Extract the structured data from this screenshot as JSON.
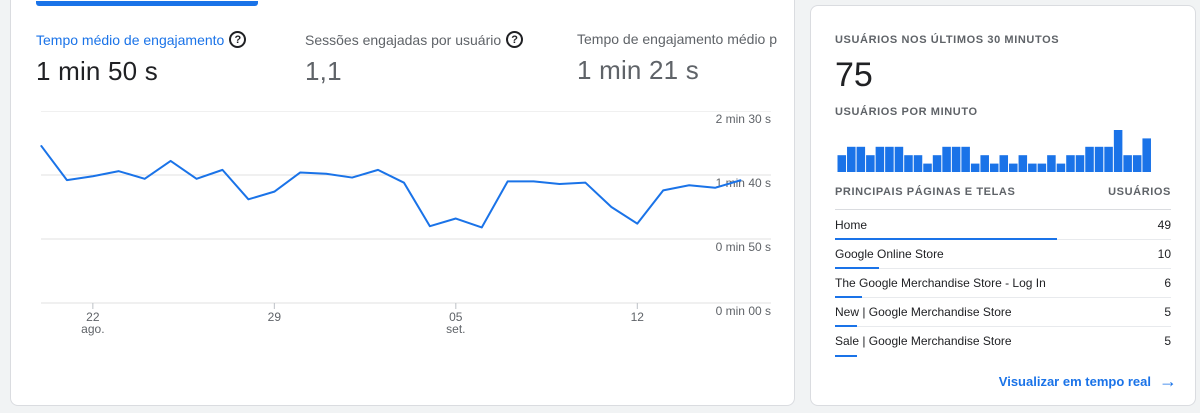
{
  "engagement_card": {
    "metrics": [
      {
        "label": "Tempo médio de engajamento",
        "value": "1 min 50 s",
        "active": true
      },
      {
        "label": "Sessões engajadas por usuário",
        "value": "1,1"
      },
      {
        "label": "Tempo de engajamento médio p",
        "value": "1 min 21 s"
      }
    ],
    "chart_data": {
      "type": "line",
      "y_ticks": [
        "2 min 30 s",
        "1 min 40 s",
        "0 min 50 s",
        "0 min 00 s"
      ],
      "y_tick_values": [
        150,
        100,
        50,
        0
      ],
      "ylim": [
        0,
        150
      ],
      "x_ticks": [
        {
          "day": "22",
          "month": "ago.",
          "index": 2
        },
        {
          "day": "29",
          "month": "",
          "index": 9
        },
        {
          "day": "05",
          "month": "set.",
          "index": 16
        },
        {
          "day": "12",
          "month": "",
          "index": 23
        }
      ],
      "series": [
        {
          "values": [
            123,
            96,
            99,
            103,
            97,
            111,
            97,
            104,
            81,
            87,
            102,
            101,
            98,
            104,
            94,
            60,
            66,
            59,
            95,
            95,
            93,
            94,
            75,
            62,
            88,
            92,
            90,
            96
          ],
          "color": "#1a73e8"
        }
      ],
      "grid": true
    }
  },
  "realtime_card": {
    "title": "USUÁRIOS NOS ÚLTIMOS 30 MINUTOS",
    "count": "75",
    "per_minute_label": "USUÁRIOS POR MINUTO",
    "per_minute_values": [
      2,
      3,
      3,
      2,
      3,
      3,
      3,
      2,
      2,
      1,
      2,
      3,
      3,
      3,
      1,
      2,
      1,
      2,
      1,
      2,
      1,
      1,
      2,
      1,
      2,
      2,
      3,
      3,
      3,
      5,
      2,
      2,
      4,
      0
    ],
    "table_headers": [
      "PRINCIPAIS PÁGINAS E TELAS",
      "USUÁRIOS"
    ],
    "rows": [
      {
        "name": "Home",
        "value": "49",
        "share": 1.0
      },
      {
        "name": "Google Online Store",
        "value": "10",
        "share": 0.2
      },
      {
        "name": "The Google Merchandise Store - Log In",
        "value": "6",
        "share": 0.12
      },
      {
        "name": "New | Google Merchandise Store",
        "value": "5",
        "share": 0.1
      },
      {
        "name": "Sale | Google Merchandise Store",
        "value": "5",
        "share": 0.1
      }
    ],
    "link_label": "Visualizar em tempo real",
    "accent": "#1a73e8"
  }
}
